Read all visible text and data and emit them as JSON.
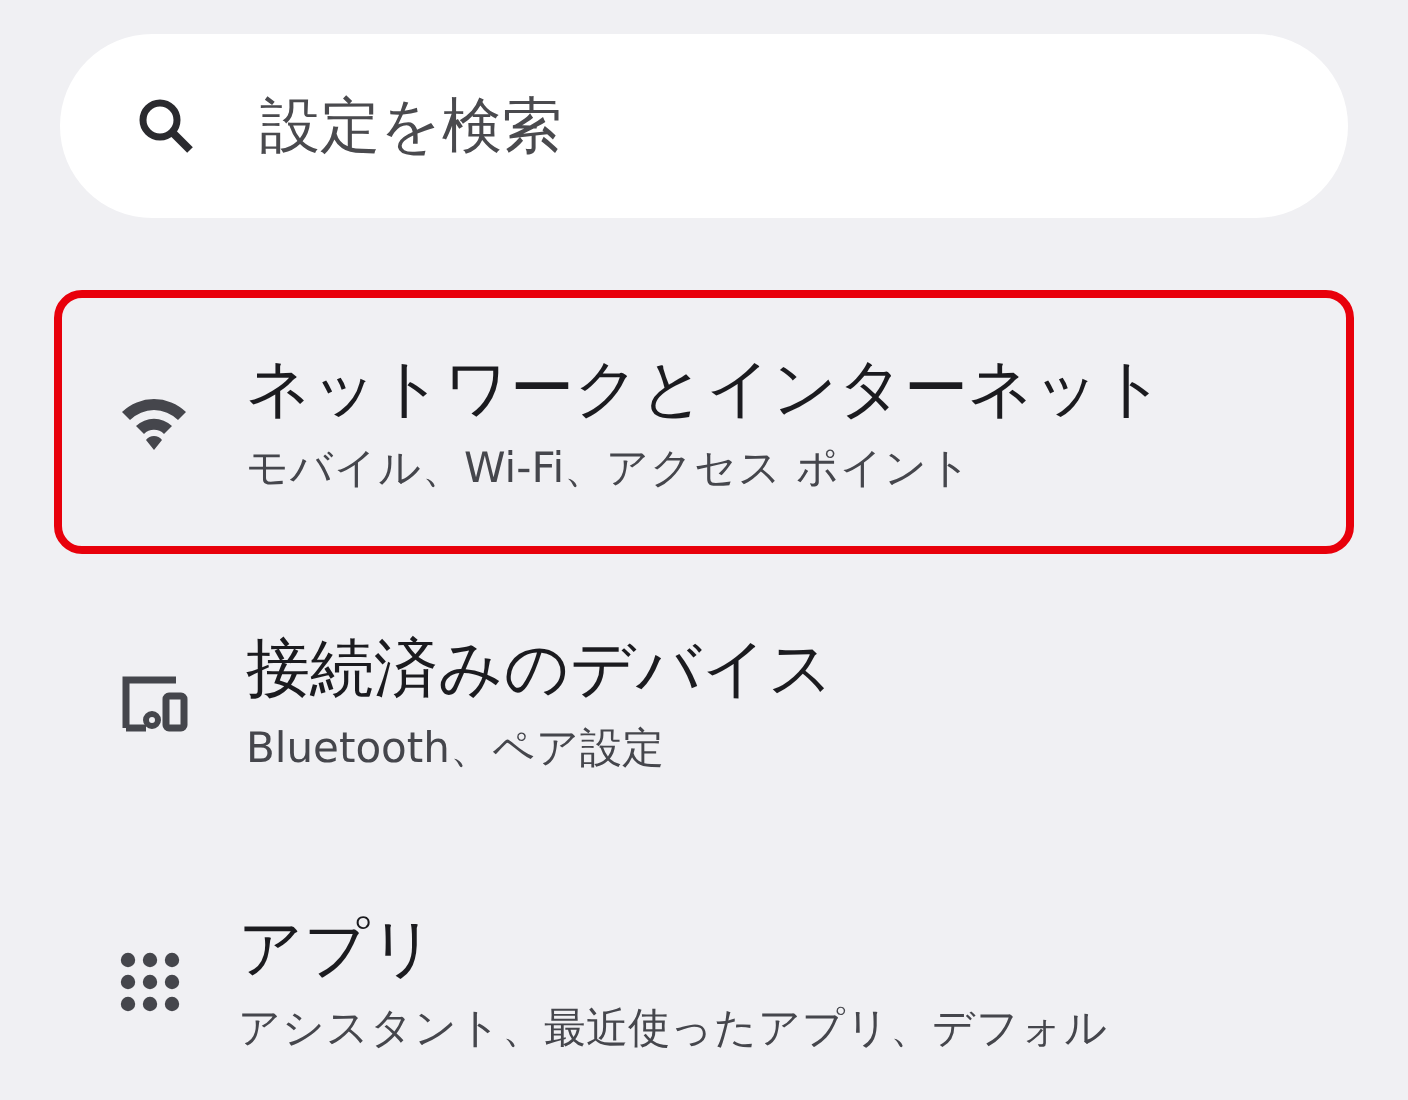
{
  "search": {
    "placeholder": "設定を検索"
  },
  "items": [
    {
      "kind": "wifi",
      "title": "ネットワークとインターネット",
      "subtitle": "モバイル、Wi-Fi、アクセス ポイント",
      "highlighted": true
    },
    {
      "kind": "devices",
      "title": "接続済みのデバイス",
      "subtitle": "Bluetooth、ペア設定",
      "highlighted": false
    },
    {
      "kind": "apps",
      "title": "アプリ",
      "subtitle": "アシスタント、最近使ったアプリ、デフォル",
      "highlighted": false
    }
  ]
}
